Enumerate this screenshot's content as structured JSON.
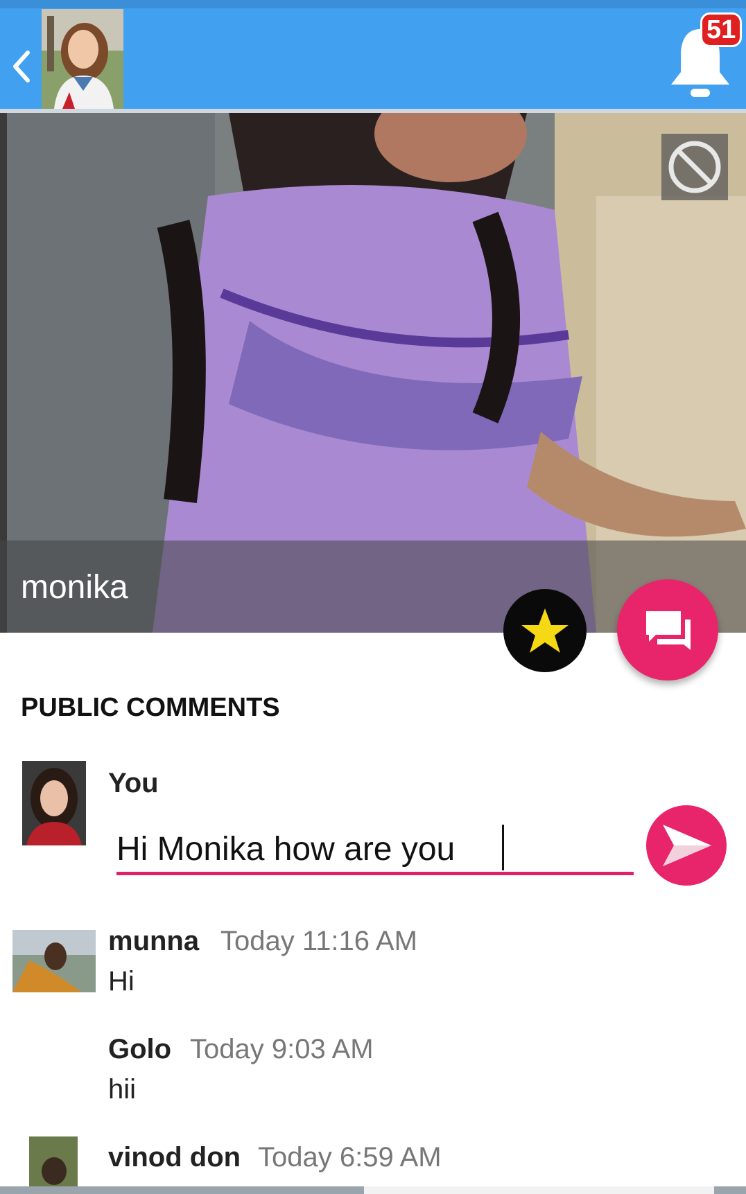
{
  "header": {
    "back_icon": "chevron-left-icon",
    "bell_icon": "bell-icon",
    "notification_count": "51"
  },
  "profile": {
    "name": "monika",
    "block_icon": "block-icon",
    "favorite_icon": "star-icon",
    "chat_icon": "chat-icon"
  },
  "comments": {
    "section_title": "PUBLIC COMMENTS",
    "composer": {
      "author": "You",
      "value": "Hi Monika how are you",
      "send_icon": "send-icon"
    },
    "items": [
      {
        "name": "munna",
        "time": "Today 11:16 AM",
        "text": "Hi"
      },
      {
        "name": "Golo",
        "time": "Today 9:03 AM",
        "text": "hii"
      },
      {
        "name": "vinod don",
        "time": "Today 6:59 AM",
        "text": ""
      }
    ]
  },
  "colors": {
    "app_bar": "#42a0f0",
    "accent": "#e8256a",
    "badge": "#e02020"
  }
}
